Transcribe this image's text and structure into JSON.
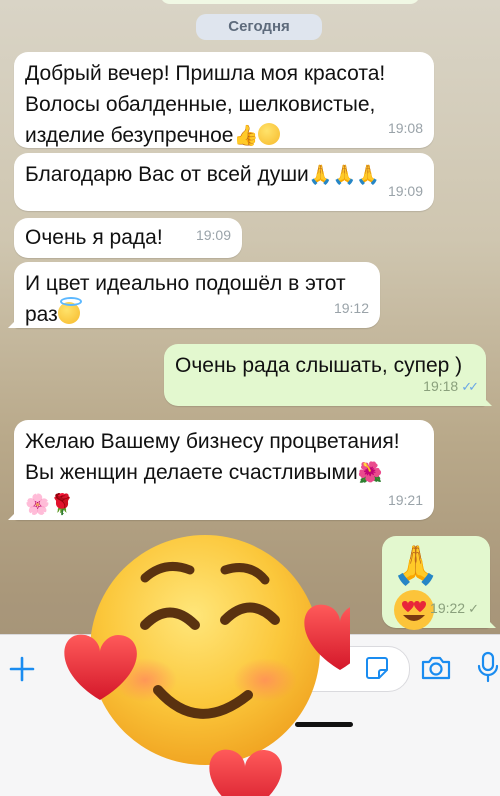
{
  "date_separator": "Сегодня",
  "messages": [
    {
      "direction": "in",
      "text": "Добрый вечер! Пришла моя красота!\nВолосы обалденные, шелковистые,\nизделие безупречное",
      "time": "19:08"
    },
    {
      "direction": "in",
      "text": "Благодарю Вас от всей души",
      "time": "19:09"
    },
    {
      "direction": "in",
      "text": "Очень я рада!",
      "time": "19:09"
    },
    {
      "direction": "in",
      "text": "И цвет идеально подошёл в этот\nраз",
      "time": "19:12"
    },
    {
      "direction": "out",
      "text": "Очень рада слышать, супер )",
      "time": "19:18",
      "status": "read"
    },
    {
      "direction": "in",
      "text": "Желаю Вашему бизнесу процветания!\nВы женщин делаете счастливыми",
      "time": "19:21"
    },
    {
      "direction": "out",
      "text": "",
      "time": "19:22",
      "status": "sent"
    }
  ],
  "icons": {
    "attach": "plus-icon",
    "sticker": "sticker-icon",
    "camera": "camera-icon",
    "mic": "microphone-icon"
  },
  "colors": {
    "accent": "#1a8cf0",
    "outgoing_bubble": "#e3f8cf",
    "incoming_bubble": "#ffffff"
  }
}
